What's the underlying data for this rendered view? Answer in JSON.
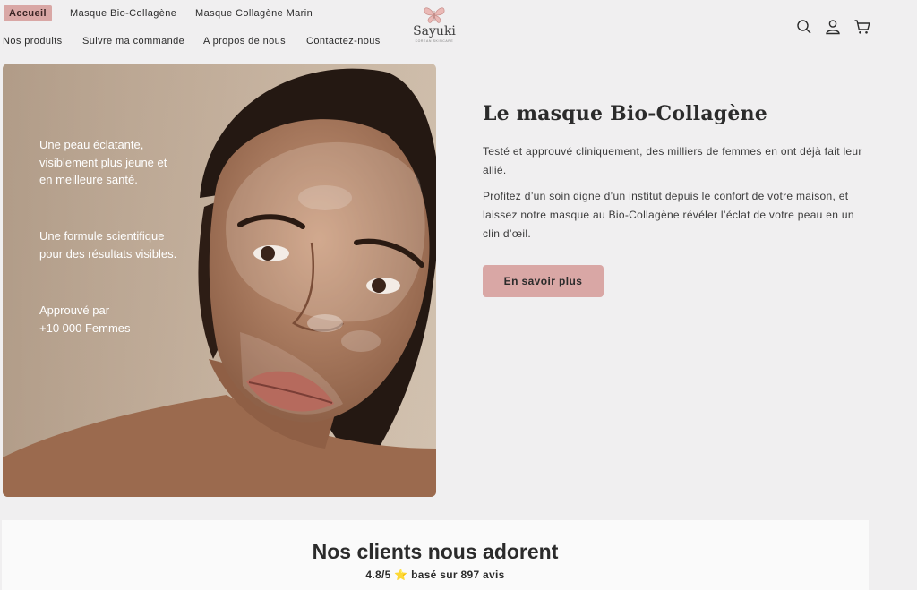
{
  "nav": {
    "row1": [
      "Accueil",
      "Masque Bio-Collagène",
      "Masque Collagène Marin"
    ],
    "row2": [
      "Nos produits",
      "Suivre ma commande",
      "A propos de nous",
      "Contactez-nous"
    ]
  },
  "logo": {
    "name": "Sayuki",
    "tagline": "KOREAN SKINCARE"
  },
  "header_icons": [
    "search-icon",
    "account-icon",
    "cart-icon"
  ],
  "hero": {
    "overlay": [
      "Une peau éclatante,\nvisiblement plus jeune et\nen meilleure santé.",
      "Une formule scientifique\npour des résultats visibles.",
      "Approuvé par\n+10 000 Femmes"
    ],
    "title": "Le masque Bio-Collagène",
    "paragraph1": "Testé et approuvé cliniquement, des milliers de femmes en ont déjà fait leur allié.",
    "paragraph2": "Profitez d’un soin digne d’un institut depuis le confort de votre maison, et laissez notre masque au Bio-Collagène révéler l’éclat de votre peau en un clin d’œil.",
    "cta": "En savoir plus"
  },
  "reviews": {
    "title": "Nos clients nous adorent",
    "rating": "4.8/5",
    "star": "⭐",
    "based_on": "basé sur 897 avis"
  },
  "colors": {
    "accent": "#d9a7a5",
    "background": "#f0eff0",
    "panel": "#fafafa",
    "text": "#2b2b2b"
  }
}
